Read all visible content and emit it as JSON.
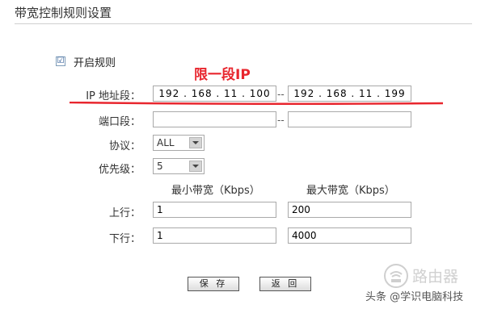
{
  "page": {
    "title": "带宽控制规则设置"
  },
  "enable": {
    "checked": true,
    "check_mark": "☑",
    "label": "开启规则"
  },
  "annotation": {
    "text": "限一段IP"
  },
  "ip_range": {
    "label": "IP 地址段：",
    "start": "192 . 168 . 11 . 100",
    "end": "192 . 168 . 11 . 199",
    "separator": "--"
  },
  "port_range": {
    "label": "端口段：",
    "start": "",
    "end": "",
    "separator": "--"
  },
  "protocol": {
    "label": "协议：",
    "value": "ALL"
  },
  "priority": {
    "label": "优先级：",
    "value": "5"
  },
  "bandwidth": {
    "min_header": "最小带宽（Kbps）",
    "max_header": "最大带宽（Kbps）",
    "upload": {
      "label": "上行：",
      "min": "1",
      "max": "200"
    },
    "download": {
      "label": "下行：",
      "min": "1",
      "max": "4000"
    }
  },
  "buttons": {
    "save": "保 存",
    "back": "返 回"
  },
  "watermark": {
    "logo_text": "路由器",
    "caption": "头条 @学识电脑科技"
  },
  "colors": {
    "annotation_red": "#e8262e",
    "border": "#a9a9a9"
  }
}
